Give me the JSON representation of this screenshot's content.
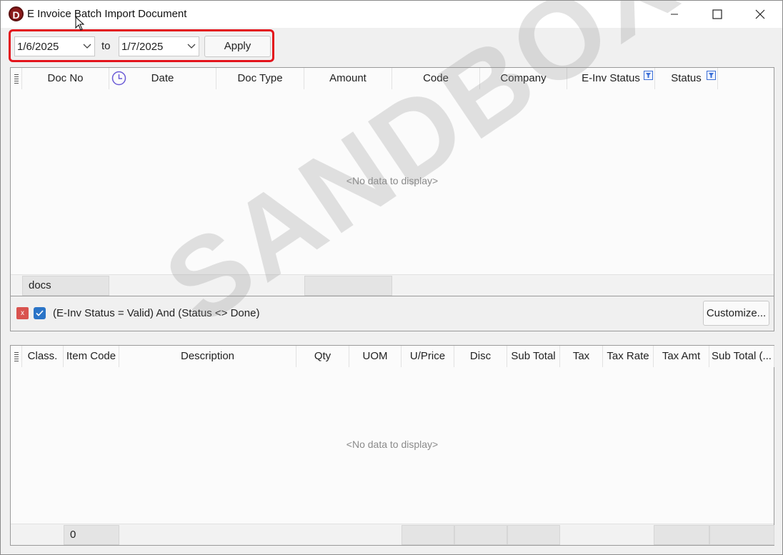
{
  "window": {
    "title": "E Invoice Batch Import Document",
    "icon_letter": "D"
  },
  "toolbar": {
    "date_from": "1/6/2025",
    "to_label": "to",
    "date_to": "1/7/2025",
    "apply_label": "Apply"
  },
  "top_grid": {
    "columns": [
      "Doc No",
      "Date",
      "Doc Type",
      "Amount",
      "Code",
      "Company",
      "E-Inv Status",
      "Status"
    ],
    "no_data": "<No data to display>",
    "footer_summary": "docs"
  },
  "filter": {
    "text": "(E-Inv Status = Valid) And (Status <> Done)",
    "clear_label": "x",
    "customize_label": "Customize..."
  },
  "bottom_grid": {
    "columns": [
      "Class.",
      "Item Code",
      "Description",
      "Qty",
      "UOM",
      "U/Price",
      "Disc",
      "Sub Total",
      "Tax",
      "Tax Rate",
      "Tax Amt",
      "Sub Total (..."
    ],
    "no_data": "<No data to display>",
    "footer_count": "0"
  },
  "watermark": "SANDBOX"
}
